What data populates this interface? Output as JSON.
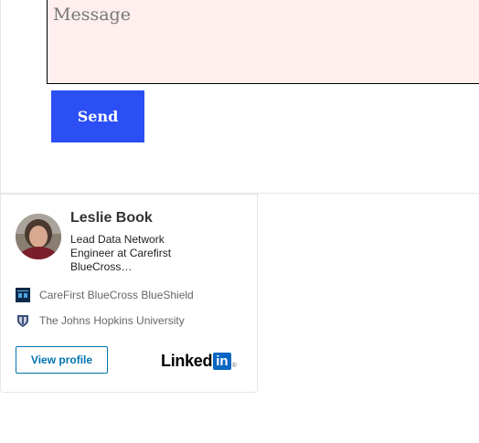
{
  "form": {
    "message_placeholder": "Message",
    "message_value": "",
    "send_label": "Send"
  },
  "badge": {
    "name": "Leslie Book",
    "headline": "Lead Data Network Engineer at Carefirst BlueCross…",
    "organizations": [
      {
        "name": "CareFirst BlueCross BlueShield",
        "icon": "carefirst-logo-icon"
      },
      {
        "name": "The Johns Hopkins University",
        "icon": "jhu-shield-icon"
      }
    ],
    "view_profile_label": "View profile",
    "brand": {
      "word": "Linked",
      "in": "in",
      "reg": "®",
      "color": "#0a66c2"
    }
  },
  "colors": {
    "send_button": "#2b4ff5",
    "message_bg": "#feeeed",
    "accent_link": "#0073b1"
  }
}
